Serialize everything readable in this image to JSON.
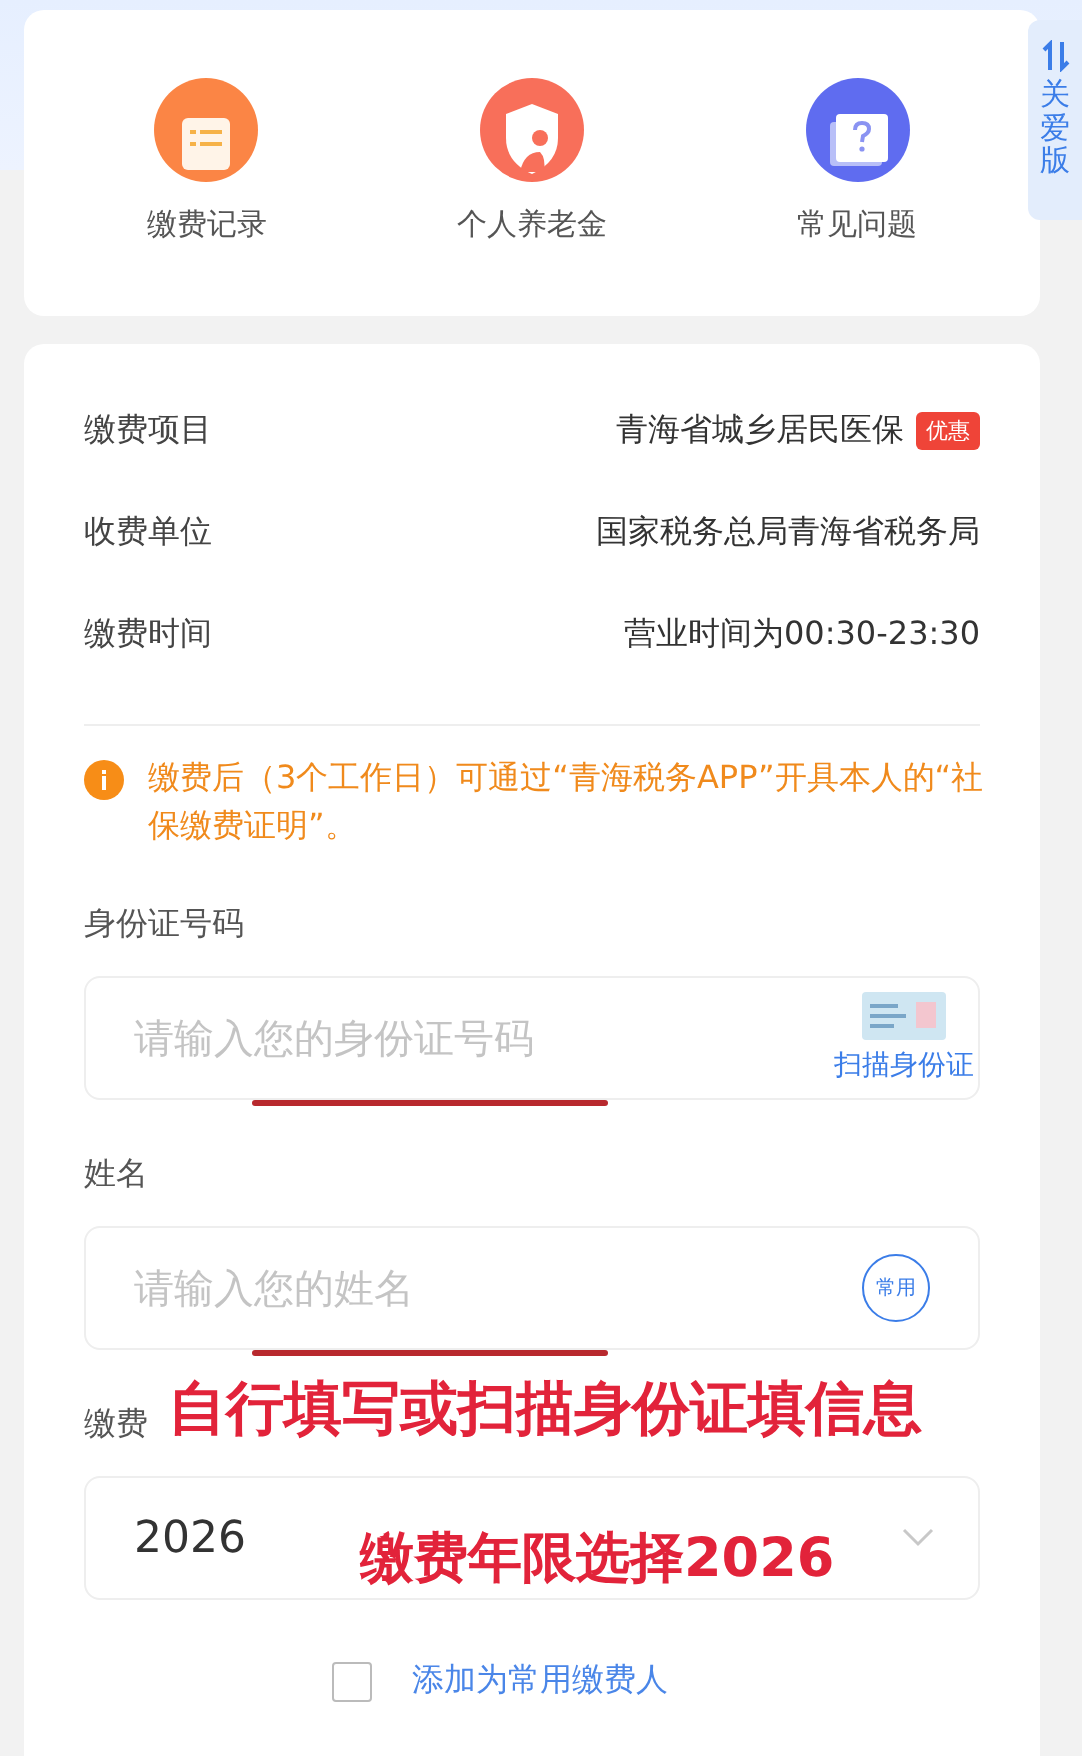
{
  "shortcuts": [
    {
      "label": "缴费记录",
      "kind": "record"
    },
    {
      "label": "个人养老金",
      "kind": "pension"
    },
    {
      "label": "常见问题",
      "kind": "faq"
    }
  ],
  "care_tab": {
    "label": "关爱版"
  },
  "info_rows": [
    {
      "label": "缴费项目",
      "value": "青海省城乡居民医保",
      "badge": "优惠"
    },
    {
      "label": "收费单位",
      "value": "国家税务总局青海省税务局"
    },
    {
      "label": "缴费时间",
      "value": "营业时间为00:30-23:30"
    }
  ],
  "notice": "缴费后（3个工作日）可通过“青海税务APP”开具本人的“社保缴费证明”。",
  "fields": [
    {
      "label": "身份证号码",
      "placeholder": "请输入您的身份证号码",
      "kind": "scan",
      "action": "扫描身份证",
      "underlined": true
    },
    {
      "label": "姓名",
      "placeholder": "请输入您的姓名",
      "kind": "common",
      "action": "常用",
      "underlined": true
    },
    {
      "label": "缴费",
      "value": "2026",
      "kind": "select",
      "underlined": false
    }
  ],
  "add_common": {
    "label": "添加为常用缴费人",
    "checked": false
  },
  "annotations": [
    "自行填写或扫描身份证填信息",
    "缴费年限选择2026"
  ]
}
